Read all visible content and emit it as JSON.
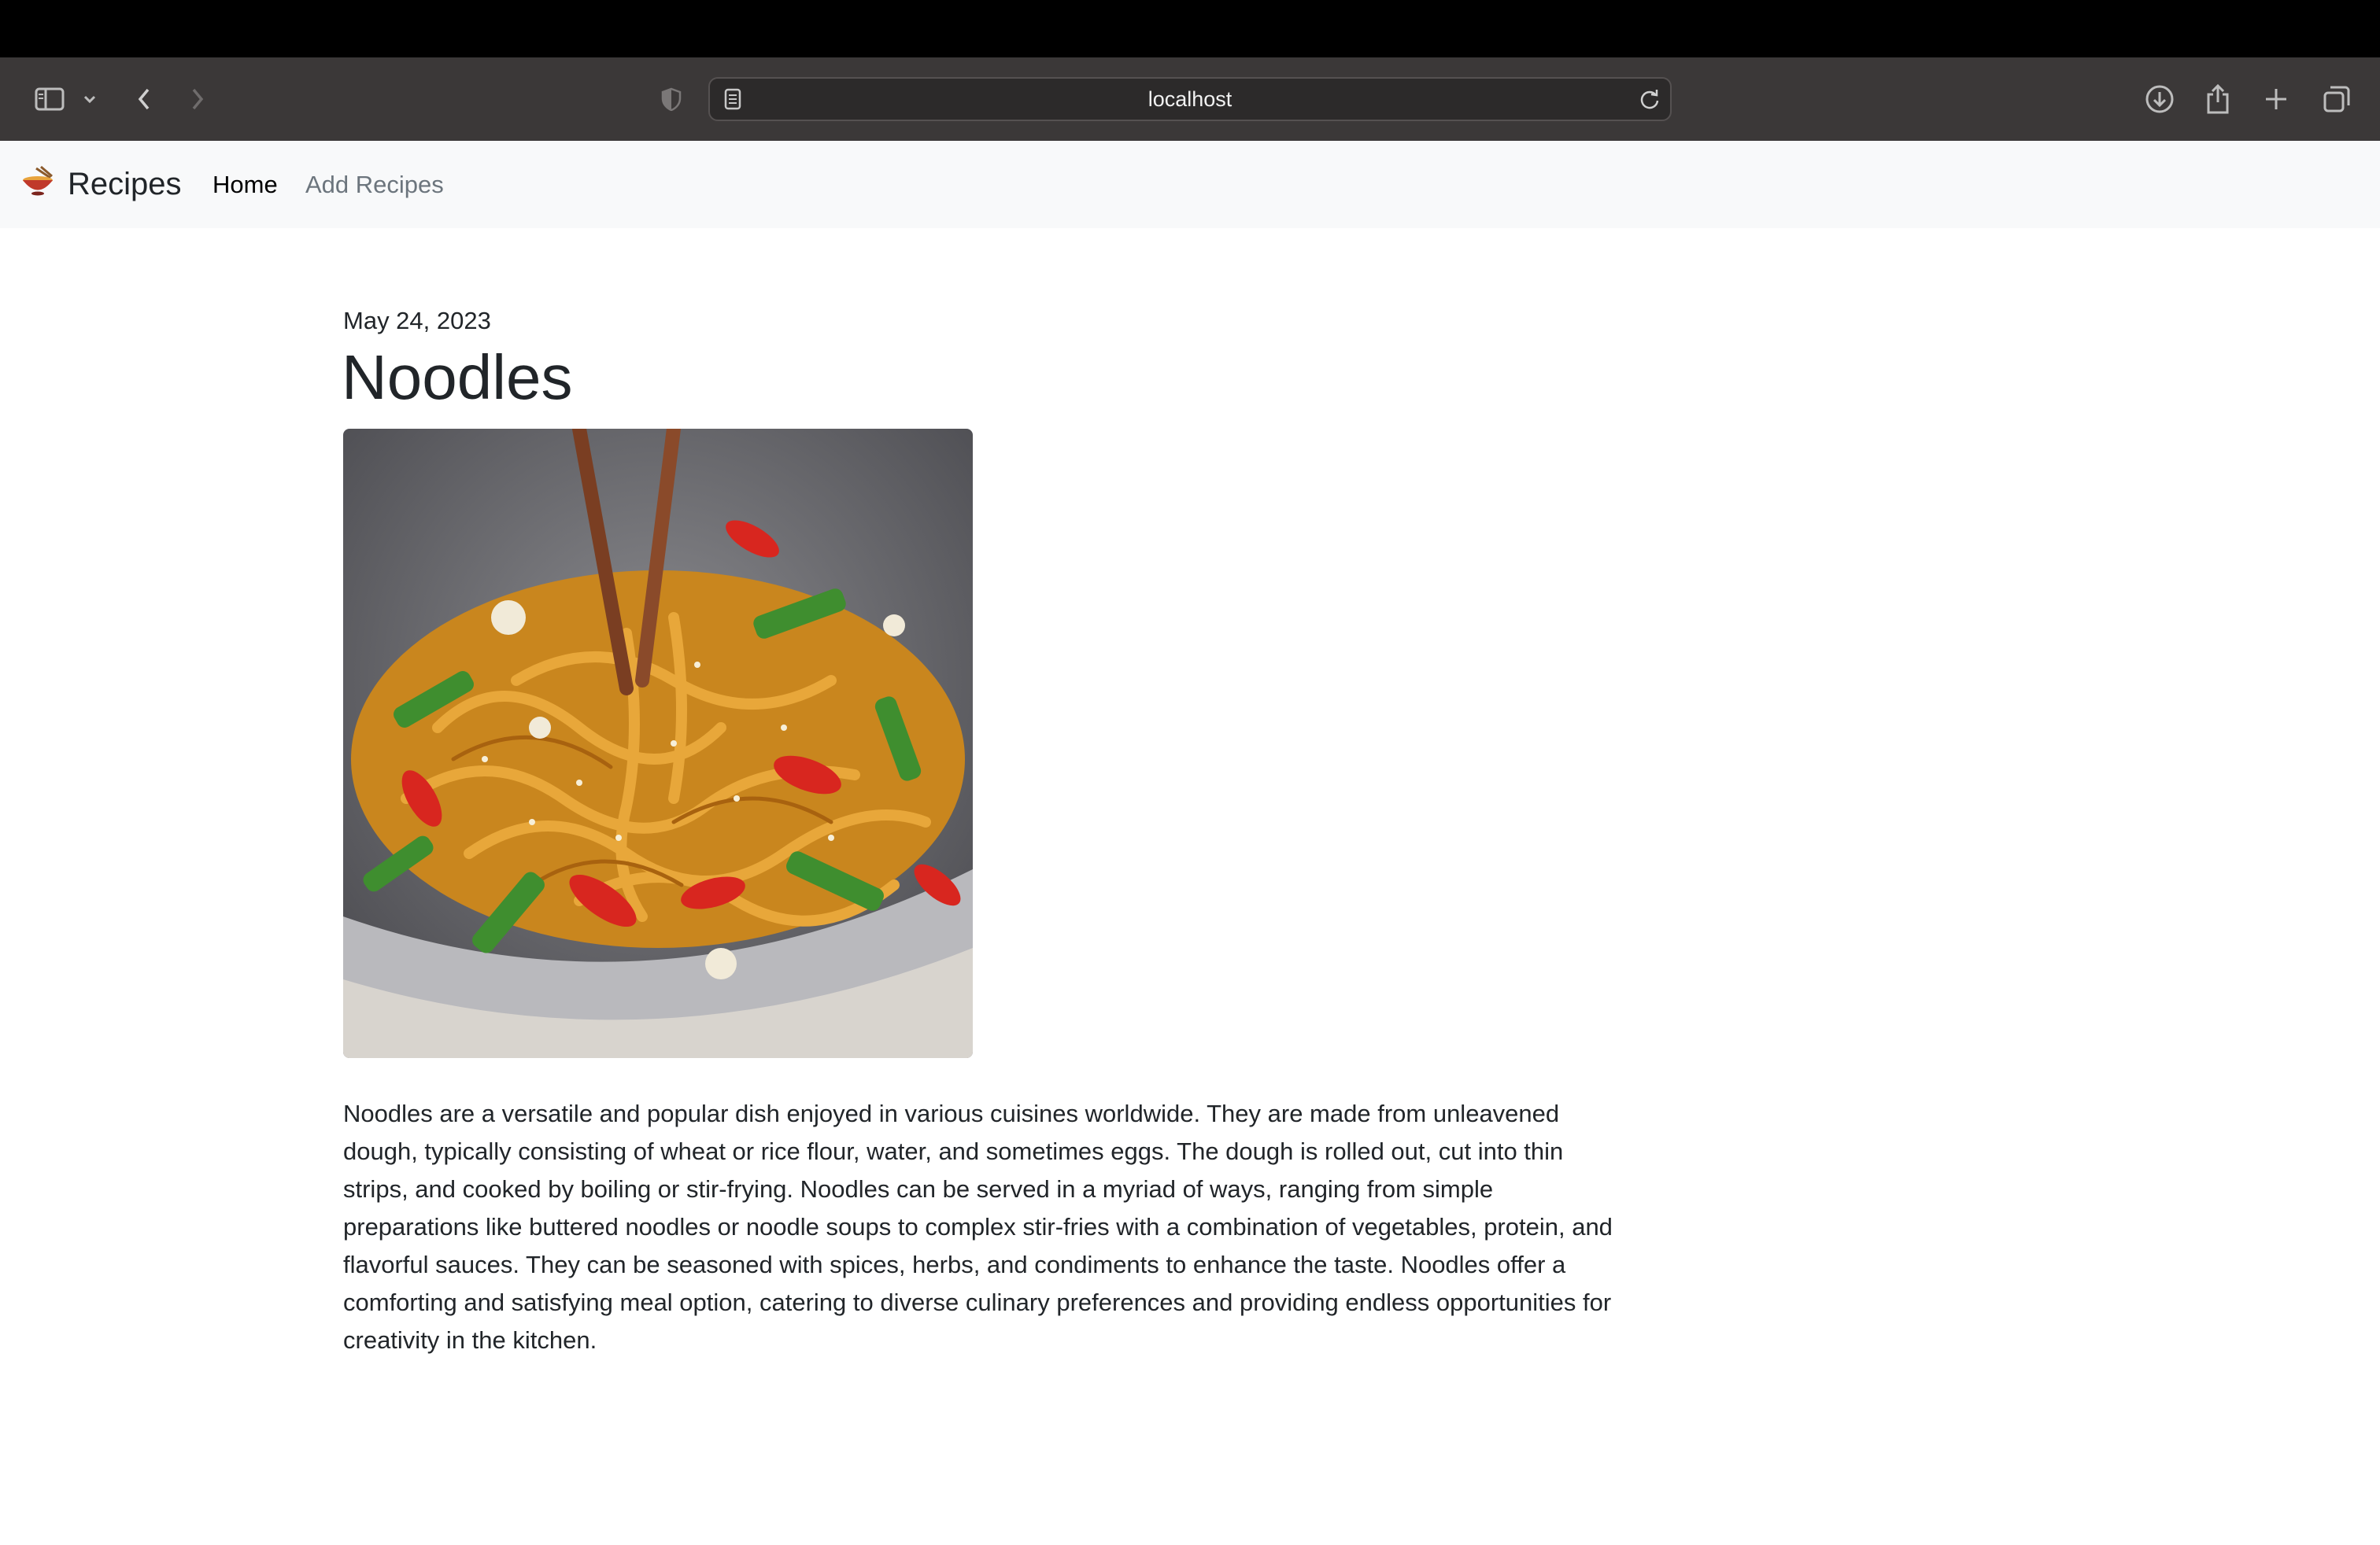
{
  "browser": {
    "url": "localhost"
  },
  "navbar": {
    "brand_label": "Recipes",
    "links": [
      {
        "label": "Home"
      },
      {
        "label": "Add Recipes"
      }
    ]
  },
  "recipe": {
    "date": "May 24, 2023",
    "title": "Noodles",
    "description": "Noodles are a versatile and popular dish enjoyed in various cuisines worldwide. They are made from unleavened dough, typically consisting of wheat or rice flour, water, and sometimes eggs. The dough is rolled out, cut into thin strips, and cooked by boiling or stir-frying. Noodles can be served in a myriad of ways, ranging from simple preparations like buttered noodles or noodle soups to complex stir-fries with a combination of vegetables, protein, and flavorful sauces. They can be seasoned with spices, herbs, and condiments to enhance the taste. Noodles offer a comforting and satisfying meal option, catering to diverse culinary preferences and providing endless opportunities for creativity in the kitchen.",
    "image_subject": "stir-fried noodles with peppers in a wok"
  },
  "colors": {
    "toolbar": "#3b3838",
    "navbar": "#f8f9fa",
    "nav_active": "#000000",
    "nav_inactive": "#6c757d"
  }
}
